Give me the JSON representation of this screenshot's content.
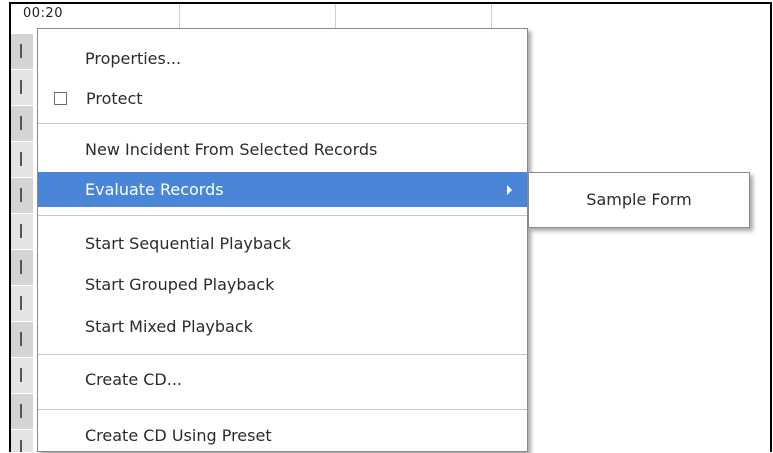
{
  "timeline": {
    "time_label": "00:20"
  },
  "context_menu": {
    "items": [
      {
        "label": "Properties..."
      },
      {
        "label": "Protect",
        "checked": false
      },
      {
        "label": "New Incident From Selected Records"
      },
      {
        "label": "Evaluate Records",
        "highlighted": true,
        "has_submenu": true
      },
      {
        "label": "Start Sequential Playback"
      },
      {
        "label": "Start Grouped Playback"
      },
      {
        "label": "Start Mixed Playback"
      },
      {
        "label": "Create CD..."
      },
      {
        "label": "Create CD Using Preset"
      }
    ]
  },
  "submenu": {
    "items": [
      {
        "label": "Sample Form"
      }
    ]
  },
  "colors": {
    "highlight": "#4a86d8",
    "menu_text": "#2b2b2b",
    "separator": "#c8c8c8"
  }
}
